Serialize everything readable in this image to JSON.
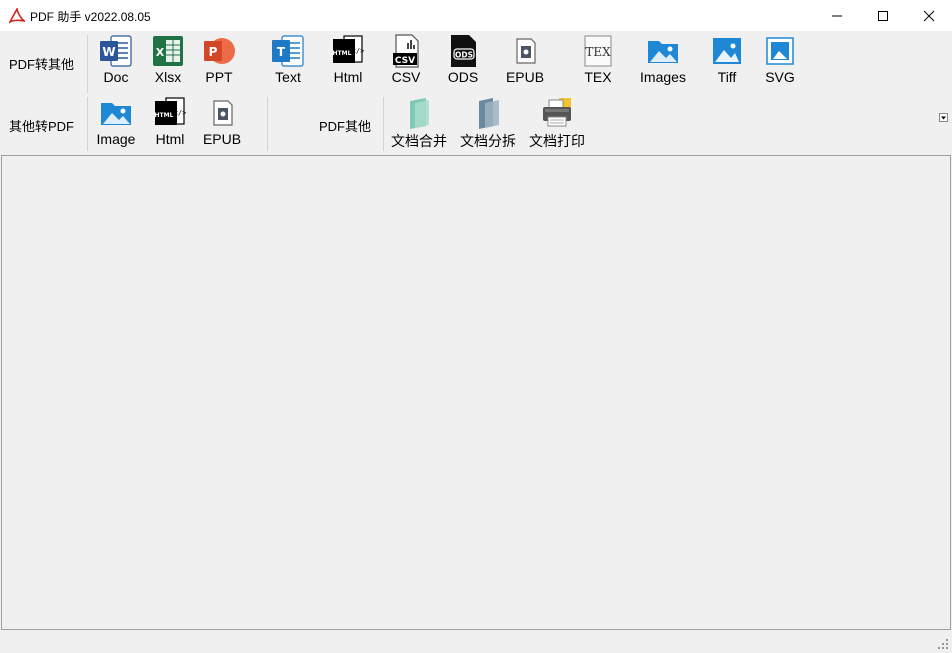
{
  "window": {
    "title": "PDF 助手 v2022.08.05",
    "logo_icon": "pdf-logo-icon",
    "controls": [
      "minimize-icon",
      "maximize-icon",
      "close-icon"
    ]
  },
  "ribbon": {
    "row1": {
      "label": "PDF转其他",
      "tools": [
        {
          "label": "Doc",
          "icon": "word-icon"
        },
        {
          "label": "Xlsx",
          "icon": "excel-icon"
        },
        {
          "label": "PPT",
          "icon": "powerpoint-icon"
        },
        {
          "label": "Text",
          "icon": "text-doc-icon"
        },
        {
          "label": "Html",
          "icon": "html-icon"
        },
        {
          "label": "CSV",
          "icon": "csv-icon"
        },
        {
          "label": "ODS",
          "icon": "ods-icon"
        },
        {
          "label": "EPUB",
          "icon": "epub-icon"
        },
        {
          "label": "TEX",
          "icon": "tex-icon"
        },
        {
          "label": "Images",
          "icon": "images-icon"
        },
        {
          "label": "Tiff",
          "icon": "tiff-icon"
        },
        {
          "label": "SVG",
          "icon": "svg-icon"
        }
      ]
    },
    "row2": {
      "label": "其他转PDF",
      "tools": [
        {
          "label": "Image",
          "icon": "image-icon"
        },
        {
          "label": "Html",
          "icon": "html-icon"
        },
        {
          "label": "EPUB",
          "icon": "epub-icon"
        }
      ]
    },
    "row3": {
      "label": "PDF其他",
      "tools": [
        {
          "label": "文档合并",
          "icon": "merge-icon"
        },
        {
          "label": "文档分拆",
          "icon": "split-icon"
        },
        {
          "label": "文档打印",
          "icon": "printer-icon"
        }
      ]
    }
  },
  "colors": {
    "word": "#2b579a",
    "excel": "#217346",
    "powerpoint": "#d24726",
    "text": "#1e7ac4",
    "image_blue": "#1e88d6",
    "window_bg": "#f0f0f0"
  }
}
